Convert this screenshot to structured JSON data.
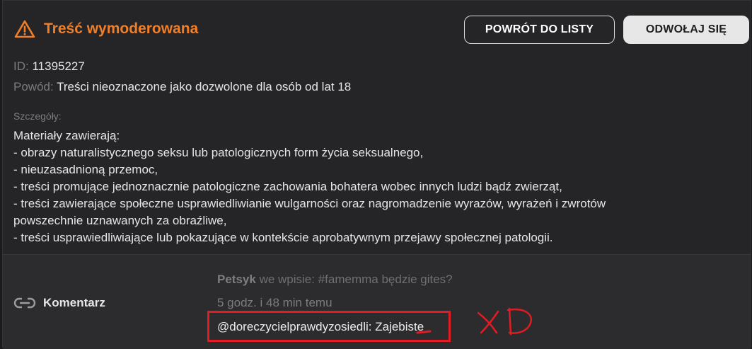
{
  "header": {
    "title": "Treść wymoderowana",
    "icon": "warning-triangle-icon",
    "accent_color": "#f07f2a"
  },
  "buttons": {
    "back_label": "POWRÓT DO LISTY",
    "appeal_label": "ODWOŁAJ SIĘ"
  },
  "info": {
    "id_label": "ID:",
    "id_value": "11395227",
    "reason_label": "Powód:",
    "reason_value": "Treści nieoznaczone jako dozwolone dla osób od lat 18",
    "details_label": "Szczegóły:",
    "details_lines": [
      "Materiały zawierają:",
      "- obrazy naturalistycznego seksu lub patologicznych form życia seksualnego,",
      "- nieuzasadnioną przemoc,",
      "- treści promujące jednoznacznie patologiczne zachowania bohatera wobec innych ludzi bądź zwierząt,",
      "- treści zawierające społeczne usprawiedliwianie wulgarności oraz nagromadzenie wyrazów, wyrażeń i zwrotów",
      "powszechnie uznawanych za obraźliwe,",
      "- treści usprawiedliwiające lub pokazujące w kontekście aprobatywnym przejawy społecznej patologii."
    ]
  },
  "comment": {
    "icon": "link-icon",
    "label": "Komentarz",
    "author": "Petsyk",
    "context": "we wpisie: #famemma będzie gites?",
    "time": "5 godz. i 48 min temu",
    "text": "@doreczycielprawdyzosiedli: Zajebiste"
  },
  "annotation": {
    "color": "#e21c22"
  }
}
